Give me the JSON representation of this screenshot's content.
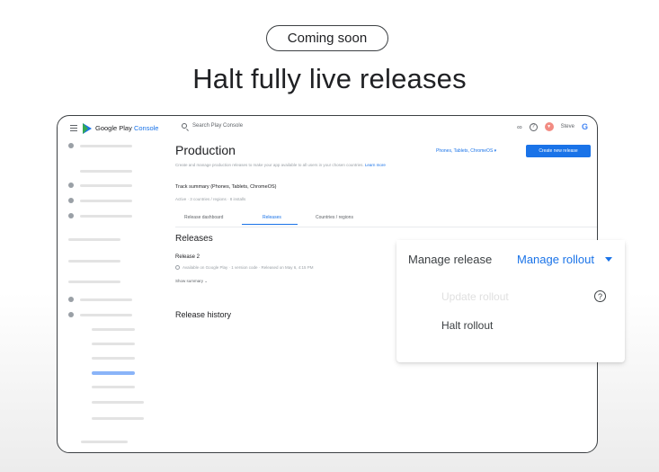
{
  "badge": "Coming soon",
  "headline": "Halt fully live releases",
  "app": {
    "brand_prefix": "Google Play",
    "brand_suffix": "Console",
    "search_placeholder": "Search Play Console",
    "user_name": "Steve",
    "google_logo": "G",
    "icons": [
      "menu-icon",
      "play-console-logo",
      "search-icon",
      "link-icon",
      "help-icon",
      "avatar",
      "google-icon"
    ]
  },
  "page": {
    "title": "Production",
    "description": "Create and manage production releases to make your app available to all users in your chosen countries.",
    "learn_more": "Learn more",
    "device_filter": "Phones, Tablets, ChromeOS ▾",
    "create_button": "Create new release",
    "track_summary": "Track summary (Phones, Tablets, ChromeOS)",
    "track_meta": "Active · 3 countries / regions · 8 installs",
    "tabs": [
      "Release dashboard",
      "Releases",
      "Countries / regions"
    ],
    "active_tab": "Releases",
    "releases_heading": "Releases",
    "release_name": "Release 2",
    "release_meta": "Available on Google Play · 1 version code · Released on May 6, 4:15 PM",
    "show_summary": "Show summary ⌄",
    "history_heading": "Release history"
  },
  "popup": {
    "manage_release": "Manage release",
    "manage_rollout": "Manage rollout",
    "menu_items": [
      "Update rollout",
      "Halt rollout"
    ],
    "help_glyph": "?"
  },
  "colors": {
    "accent": "#1a73e8",
    "text": "#202124",
    "muted": "#9aa0a6",
    "avatar": "#f28b82"
  }
}
